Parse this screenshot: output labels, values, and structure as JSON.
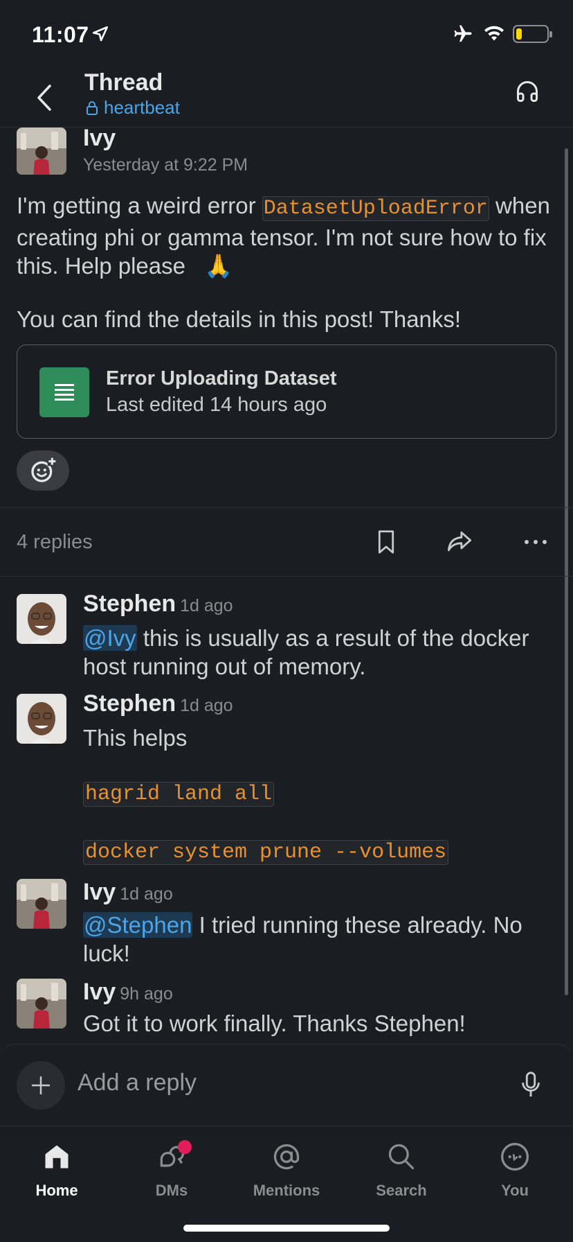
{
  "status_bar": {
    "time": "11:07",
    "battery_level": 0.18,
    "icons": [
      "location-arrow-icon",
      "airplane-icon",
      "wifi-icon",
      "battery-icon"
    ]
  },
  "header": {
    "title": "Thread",
    "channel": "heartbeat"
  },
  "original_post": {
    "author": "Ivy",
    "timestamp": "Yesterday at 9:22 PM",
    "text_before_code": "I'm getting a weird error ",
    "inline_code": "DatasetUploadError",
    "text_after_code": " when creating phi or gamma tensor. I'm not sure how to fix this. Help please",
    "emoji": "🙏",
    "text_second": "You can find the details in this post! Thanks!",
    "attachment": {
      "title": "Error Uploading Dataset",
      "subtitle": "Last edited 14 hours ago"
    }
  },
  "thread_bar": {
    "replies_count": "4 replies"
  },
  "replies": [
    {
      "author": "Stephen",
      "time": "1d ago",
      "mention": "@Ivy",
      "text": " this is usually as a result of the docker host running out of memory."
    },
    {
      "author": "Stephen",
      "time": "1d ago",
      "text": "This helps",
      "code_1": "hagrid land all",
      "code_2": "docker system prune --volumes"
    },
    {
      "author": "Ivy",
      "time": "1d ago",
      "mention": "@Stephen",
      "text": " I tried running these already. No luck!"
    },
    {
      "author": "Ivy",
      "time": "9h ago",
      "text": "Got it to work finally. Thanks Stephen!"
    }
  ],
  "composer": {
    "placeholder": "Add a reply"
  },
  "tabs": [
    {
      "label": "Home",
      "icon": "home-icon",
      "active": true
    },
    {
      "label": "DMs",
      "icon": "dms-icon",
      "active": false
    },
    {
      "label": "Mentions",
      "icon": "mentions-icon",
      "active": false
    },
    {
      "label": "Search",
      "icon": "search-icon",
      "active": false
    },
    {
      "label": "You",
      "icon": "you-icon",
      "active": false
    }
  ],
  "colors": {
    "background": "#1a1d21",
    "link": "#4aa5e9",
    "code": "#e8912d",
    "file_icon": "#2f8c5b",
    "badge": "#e01e5a"
  }
}
